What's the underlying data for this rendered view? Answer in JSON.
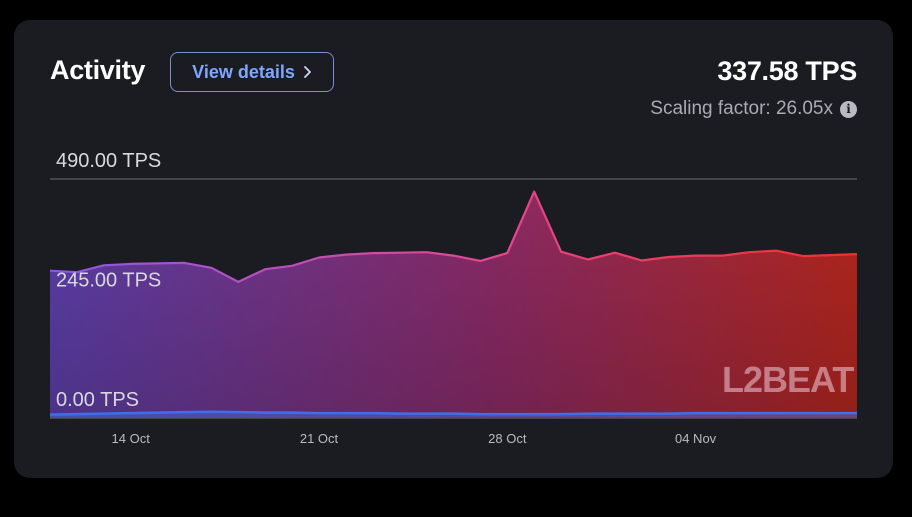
{
  "header": {
    "title": "Activity",
    "details_label": "View details",
    "value": "337.58 TPS",
    "scaling_label": "Scaling factor: 26.05x"
  },
  "watermark": "L2BEAT",
  "colors": {
    "gradient_start": "#5b3ea8",
    "gradient_mid": "#8a2a66",
    "gradient_end": "#b3261e",
    "line_start": "#8a58e6",
    "line_mid": "#e4488f",
    "line_end": "#f0302a",
    "bottom_line": "#3f6fe8"
  },
  "chart_data": {
    "type": "area",
    "title": "",
    "xlabel": "",
    "ylabel": "",
    "ylim": [
      0,
      490
    ],
    "y_ticks": [
      "490.00 TPS",
      "245.00 TPS",
      "0.00 TPS"
    ],
    "x_tick_labels": [
      "14 Oct",
      "21 Oct",
      "28 Oct",
      "04 Nov"
    ],
    "x": [
      "11 Oct",
      "12 Oct",
      "13 Oct",
      "14 Oct",
      "15 Oct",
      "16 Oct",
      "17 Oct",
      "18 Oct",
      "19 Oct",
      "20 Oct",
      "21 Oct",
      "22 Oct",
      "23 Oct",
      "24 Oct",
      "25 Oct",
      "26 Oct",
      "27 Oct",
      "28 Oct",
      "29 Oct",
      "30 Oct",
      "31 Oct",
      "01 Nov",
      "02 Nov",
      "03 Nov",
      "04 Nov",
      "05 Nov",
      "06 Nov",
      "07 Nov",
      "08 Nov",
      "09 Nov",
      "10 Nov"
    ],
    "series": [
      {
        "values": [
          302,
          299,
          313,
          316,
          317,
          318,
          308,
          279,
          305,
          312,
          329,
          335,
          338,
          339,
          340,
          333,
          322,
          338,
          464,
          341,
          325,
          339,
          323,
          330,
          333,
          333,
          340,
          343,
          332,
          334,
          336
        ]
      },
      {
        "values": [
          7,
          8,
          9,
          10,
          11,
          12,
          13,
          12,
          11,
          11,
          10,
          10,
          10,
          9,
          9,
          9,
          8,
          8,
          8,
          8,
          9,
          9,
          9,
          9,
          10,
          10,
          10,
          10,
          10,
          10,
          10
        ]
      }
    ]
  }
}
